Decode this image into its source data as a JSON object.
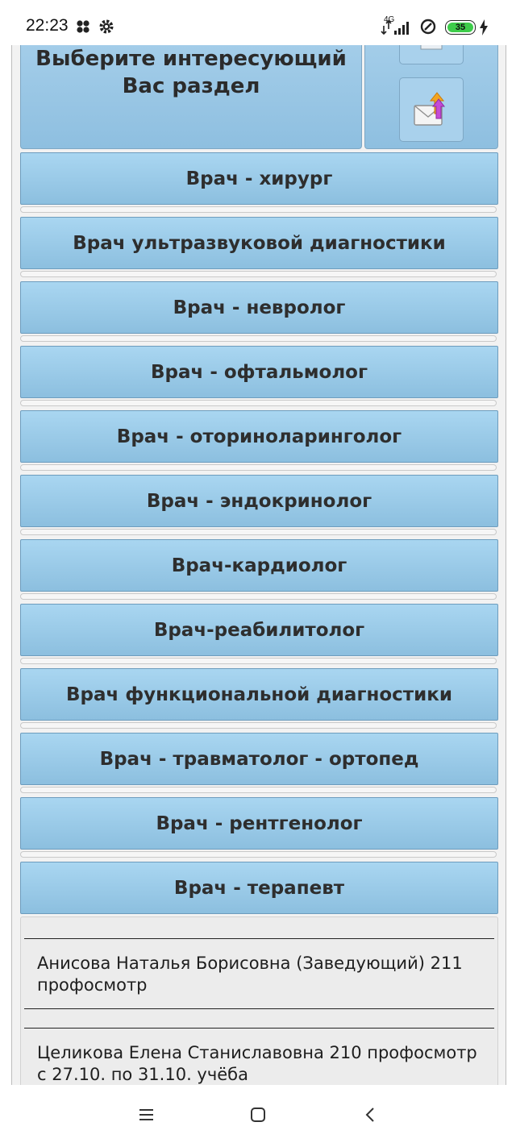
{
  "status_bar": {
    "time": "22:23",
    "network": "4G",
    "battery": "35"
  },
  "header": {
    "title": "Выберите интересующий Вас раздел",
    "icons": [
      "document-icon",
      "mail-upload-icon"
    ]
  },
  "menu": [
    {
      "label": "Врач - хирург"
    },
    {
      "label": "Врач ультразвуковой диагностики"
    },
    {
      "label": "Врач - невролог"
    },
    {
      "label": "Врач - офтальмолог"
    },
    {
      "label": "Врач - оториноларинголог"
    },
    {
      "label": "Врач - эндокринолог"
    },
    {
      "label": "Врач-кардиолог"
    },
    {
      "label": "Врач-реабилитолог"
    },
    {
      "label": "Врач функциональной диагностики"
    },
    {
      "label": "Врач - травматолог - ортопед"
    },
    {
      "label": "Врач - рентгенолог"
    },
    {
      "label": "Врач - терапевт"
    }
  ],
  "doctors": [
    {
      "text": "Анисова Наталья Борисовна (Заведующий) 211 профосмотр"
    },
    {
      "text": "Целикова Елена Станиславовна 210 профосмотр с 27.10. по 31.10. учёба"
    }
  ],
  "colors": {
    "button_top": "#a9d6f1",
    "button_bottom": "#8cbfdf",
    "button_text": "#2e2e2e",
    "battery_green": "#3dcc4a"
  }
}
